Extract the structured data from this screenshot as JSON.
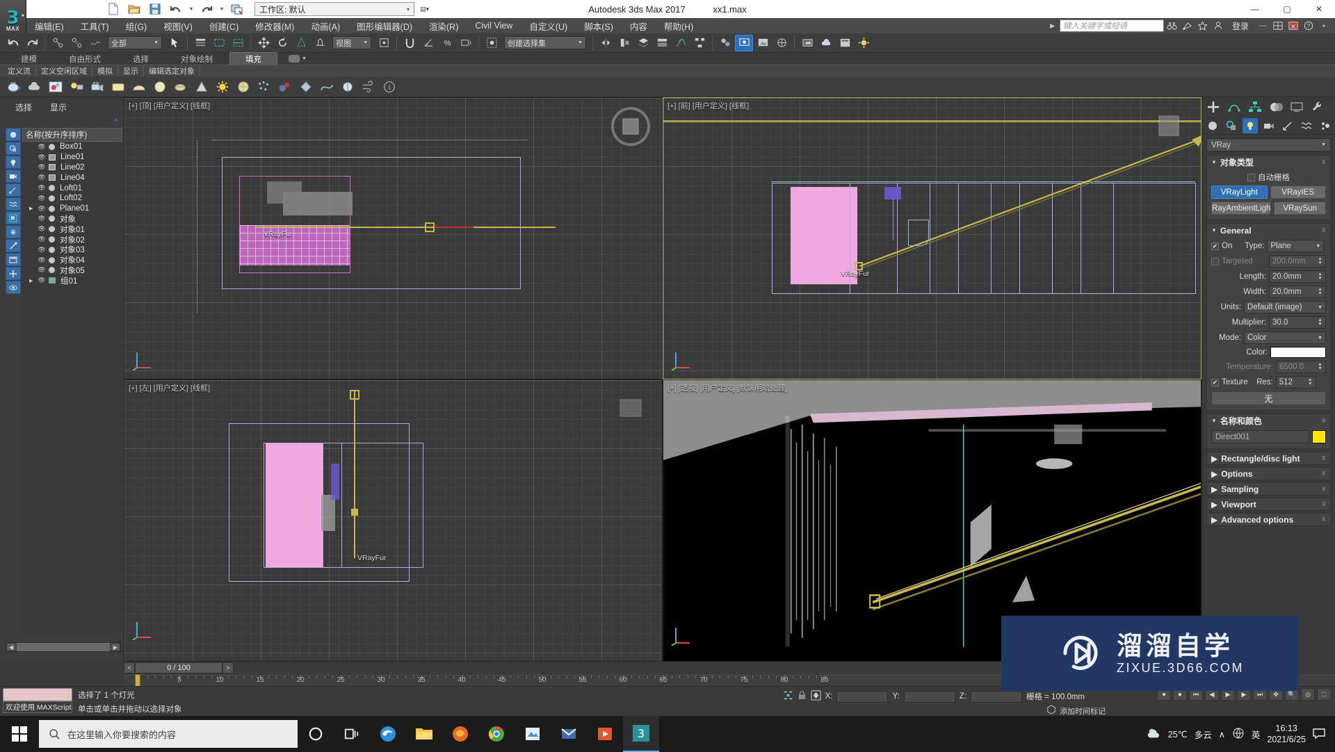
{
  "window": {
    "title": "Autodesk 3ds Max 2017",
    "filename": "xx1.max",
    "minimize": "—",
    "maximize": "▢",
    "close": "✕"
  },
  "quick_access": {
    "workspace_label": "工作区: 默认",
    "icons": [
      "new-icon",
      "open-icon",
      "save-icon",
      "undo-icon",
      "redo-icon",
      "set-project-icon"
    ]
  },
  "menu": {
    "items": [
      "编辑(E)",
      "工具(T)",
      "组(G)",
      "视图(V)",
      "创建(C)",
      "修改器(M)",
      "动画(A)",
      "图形编辑器(D)",
      "渲染(R)",
      "Civil View",
      "自定义(U)",
      "脚本(S)",
      "内容",
      "帮助(H)"
    ],
    "search_placeholder": "键入关键字或短语",
    "sign_in": "登录"
  },
  "toolbar": {
    "selection_filter": "全部",
    "ref_coord_system": "视图",
    "selection_set": "创建选择集"
  },
  "ribbon": {
    "tabs": [
      "建模",
      "自由形式",
      "选择",
      "对象绘制",
      "填充"
    ],
    "selected_tab": "填充",
    "sub_items": [
      "定义流",
      "定义空闲区域",
      "模拟",
      "显示",
      "编辑选定对象"
    ]
  },
  "scene_explorer": {
    "tab_select": "选择",
    "tab_display": "显示",
    "column_header": "名称(按升序排序)",
    "items": [
      {
        "name": "Box01",
        "type": "geom",
        "expandable": false
      },
      {
        "name": "Line01",
        "type": "shape",
        "expandable": false
      },
      {
        "name": "Line02",
        "type": "shape",
        "expandable": false
      },
      {
        "name": "Line04",
        "type": "shape",
        "expandable": false
      },
      {
        "name": "Loft01",
        "type": "geom",
        "expandable": false
      },
      {
        "name": "Loft02",
        "type": "geom",
        "expandable": false
      },
      {
        "name": "Plane01",
        "type": "geom",
        "expandable": true
      },
      {
        "name": "对象",
        "type": "geom",
        "expandable": false
      },
      {
        "name": "对象01",
        "type": "geom",
        "expandable": false
      },
      {
        "name": "对象02",
        "type": "geom",
        "expandable": false
      },
      {
        "name": "对象03",
        "type": "geom",
        "expandable": false
      },
      {
        "name": "对象04",
        "type": "geom",
        "expandable": false
      },
      {
        "name": "对象05",
        "type": "geom",
        "expandable": false
      },
      {
        "name": "组01",
        "type": "group",
        "expandable": true
      }
    ]
  },
  "viewports": [
    {
      "id": "top",
      "label": "[+] [顶] [用户定义] [线框]",
      "active": false,
      "object_label": "VRayFur"
    },
    {
      "id": "front",
      "label": "[+] [前] [用户定义] [线框]",
      "active": true,
      "object_label": "VRayFur"
    },
    {
      "id": "left",
      "label": "[+] [左] [用户定义] [线框]",
      "active": false,
      "object_label": "VRayFur"
    },
    {
      "id": "persp",
      "label": "[+] [透视] [用户定义] [默认明暗处理]",
      "active": false,
      "object_label": ""
    }
  ],
  "command_panel": {
    "renderer_dropdown": "VRay",
    "object_type": {
      "title": "对象类型",
      "autogrid_label": "自动栅格",
      "autogrid_checked": false,
      "buttons": [
        {
          "label": "VRayLight",
          "selected": true
        },
        {
          "label": "VRayIES",
          "selected": false
        },
        {
          "label": "RayAmbientLigh",
          "selected": false
        },
        {
          "label": "VRaySun",
          "selected": false
        }
      ]
    },
    "general": {
      "title": "General",
      "on_label": "On",
      "on_checked": true,
      "type_label": "Type:",
      "type_value": "Plane",
      "targeted_label": "Targeted",
      "targeted_checked": false,
      "targeted_value": "200.0mm",
      "length_label": "Length:",
      "length_value": "20.0mm",
      "width_label": "Width:",
      "width_value": "20.0mm",
      "units_label": "Units:",
      "units_value": "Default (image)",
      "multiplier_label": "Multiplier:",
      "multiplier_value": "30.0",
      "mode_label": "Mode:",
      "mode_value": "Color",
      "color_label": "Color:",
      "color_value": "#ffffff",
      "temperature_label": "Temperature:",
      "temperature_value": "6500.0",
      "texture_label": "Texture",
      "texture_checked": true,
      "res_label": "Res:",
      "res_value": "512",
      "texture_map_button": "无"
    },
    "name_and_color": {
      "title": "名称和颜色",
      "name": "Direct001",
      "color": "#ffe400"
    },
    "collapsed_rollouts": [
      "Rectangle/disc light",
      "Options",
      "Sampling",
      "Viewport",
      "Advanced options"
    ]
  },
  "timeline": {
    "prev_label": "<",
    "next_label": ">",
    "frame_field": "0 / 100",
    "ticks": [
      "5",
      "10",
      "15",
      "20",
      "25",
      "30",
      "35",
      "40",
      "45",
      "50",
      "55",
      "60",
      "65",
      "70",
      "75",
      "80",
      "85"
    ]
  },
  "status": {
    "maxscript_label": "欢迎使用 MAXScript",
    "line1": "选择了 1 个灯光",
    "line2": "单击或单击并拖动以选择对象",
    "x_label": "X:",
    "x_value": "",
    "y_label": "Y:",
    "y_value": "",
    "z_label": "Z:",
    "z_value": "",
    "grid_label": "栅格 = 100.0mm",
    "add_time_tag": "添加时间标记"
  },
  "watermark": {
    "cn": "溜溜自学",
    "en": "ZIXUE.3D66.COM"
  },
  "taskbar": {
    "search_placeholder": "在这里输入你要搜索的内容",
    "weather_temp": "25℃",
    "weather_desc": "多云",
    "ime": "英",
    "time": "16:13",
    "date": "2021/6/25",
    "apps": [
      "cortana-icon",
      "task-view-icon",
      "edge-icon",
      "explorer-icon",
      "firefox-icon",
      "chrome-icon",
      "editor-icon",
      "mail-icon",
      "media-icon",
      "max-icon"
    ]
  }
}
